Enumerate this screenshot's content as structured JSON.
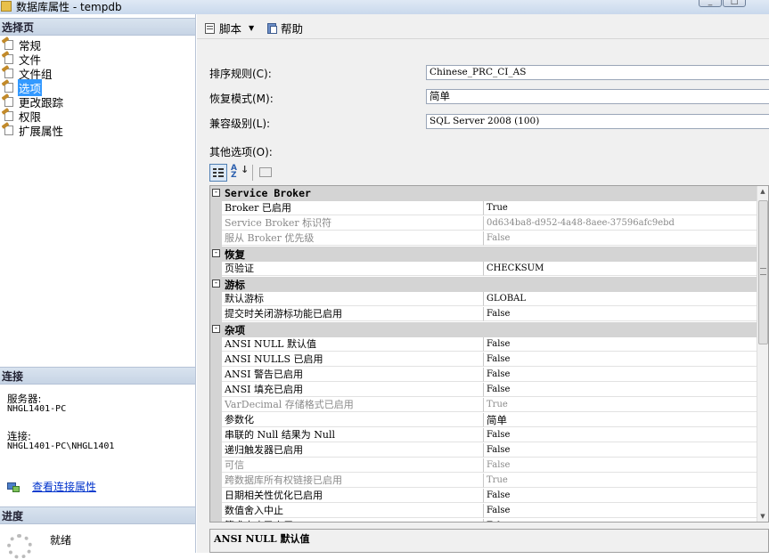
{
  "window": {
    "title": "数据库属性 - tempdb"
  },
  "left": {
    "select_page_header": "选择页",
    "pages": [
      {
        "label": "常规"
      },
      {
        "label": "文件"
      },
      {
        "label": "文件组"
      },
      {
        "label": "选项",
        "selected": true
      },
      {
        "label": "更改跟踪"
      },
      {
        "label": "权限"
      },
      {
        "label": "扩展属性"
      }
    ],
    "connection_header": "连接",
    "server_label": "服务器:",
    "server_value": "NHGL1401-PC",
    "connection_label": "连接:",
    "connection_value": "NHGL1401-PC\\NHGL1401",
    "view_connection_link": "查看连接属性",
    "progress_header": "进度",
    "progress_status": "就绪"
  },
  "toolbar": {
    "script_label": "脚本",
    "help_label": "帮助"
  },
  "fields": {
    "collation_label": "排序规则(C):",
    "collation_value": "Chinese_PRC_CI_AS",
    "recovery_label": "恢复模式(M):",
    "recovery_value": "简单",
    "compat_label": "兼容级别(L):",
    "compat_value": "SQL Server 2008 (100)",
    "other_label": "其他选项(O):"
  },
  "grid": {
    "categories": [
      {
        "name": "Service Broker",
        "toggle": "-"
      },
      {
        "name": "恢复",
        "toggle": "-"
      },
      {
        "name": "游标",
        "toggle": "-"
      },
      {
        "name": "杂项",
        "toggle": "-"
      }
    ],
    "rows": [
      {
        "cat": 0
      },
      {
        "name": "Broker 已启用",
        "value": "True",
        "readonly": false
      },
      {
        "name": "Service Broker 标识符",
        "value": "0d634ba8-d952-4a48-8aee-37596afc9ebd",
        "readonly": true
      },
      {
        "name": "服从 Broker 优先级",
        "value": "False",
        "readonly": true
      },
      {
        "cat": 1
      },
      {
        "name": "页验证",
        "value": "CHECKSUM",
        "readonly": false
      },
      {
        "cat": 2
      },
      {
        "name": "默认游标",
        "value": "GLOBAL",
        "readonly": false
      },
      {
        "name": "提交时关闭游标功能已启用",
        "value": "False",
        "readonly": false
      },
      {
        "cat": 3
      },
      {
        "name": "ANSI NULL 默认值",
        "value": "False",
        "readonly": false,
        "selected": true
      },
      {
        "name": "ANSI NULLS 已启用",
        "value": "False",
        "readonly": false
      },
      {
        "name": "ANSI 警告已启用",
        "value": "False",
        "readonly": false
      },
      {
        "name": "ANSI 填充已启用",
        "value": "False",
        "readonly": false
      },
      {
        "name": "VarDecimal 存储格式已启用",
        "value": "True",
        "readonly": true
      },
      {
        "name": "参数化",
        "value": "简单",
        "readonly": false
      },
      {
        "name": "串联的 Null 结果为 Null",
        "value": "False",
        "readonly": false
      },
      {
        "name": "递归触发器已启用",
        "value": "False",
        "readonly": false
      },
      {
        "name": "可信",
        "value": "False",
        "readonly": true
      },
      {
        "name": "跨数据库所有权链接已启用",
        "value": "True",
        "readonly": true
      },
      {
        "name": "日期相关性优化已启用",
        "value": "False",
        "readonly": false
      },
      {
        "name": "数值舍入中止",
        "value": "False",
        "readonly": false
      },
      {
        "name": "算术中止已启用",
        "value": "False",
        "readonly": false
      }
    ]
  },
  "description": {
    "title": "ANSI NULL 默认值"
  }
}
